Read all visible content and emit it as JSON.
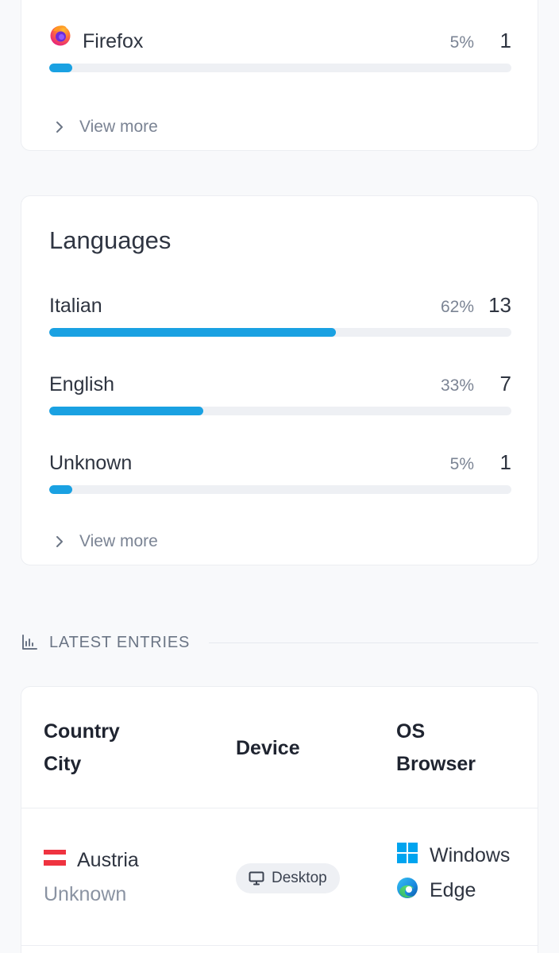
{
  "browsers_card": {
    "items": [
      {
        "label": "Firefox",
        "icon": "firefox-icon",
        "percent_text": "5%",
        "count": "1",
        "fraction": 0.05
      }
    ],
    "view_more": "View more"
  },
  "languages_card": {
    "title": "Languages",
    "items": [
      {
        "label": "Italian",
        "percent_text": "62%",
        "count": "13",
        "fraction": 0.62
      },
      {
        "label": "English",
        "percent_text": "33%",
        "count": "7",
        "fraction": 0.334
      },
      {
        "label": "Unknown",
        "percent_text": "5%",
        "count": "1",
        "fraction": 0.05
      }
    ],
    "view_more": "View more"
  },
  "latest_entries": {
    "section_label": "LATEST ENTRIES",
    "section_icon": "bar-chart-icon",
    "columns": {
      "country_city": [
        "Country",
        "City"
      ],
      "device": "Device",
      "os_browser": [
        "OS",
        "Browser"
      ]
    },
    "rows": [
      {
        "country": "Austria",
        "country_flag": "austria-flag",
        "city": "Unknown",
        "device": "Desktop",
        "device_icon": "monitor-icon",
        "os": "Windows",
        "os_icon": "windows-icon",
        "browser": "Edge",
        "browser_icon": "edge-icon"
      }
    ]
  },
  "colors": {
    "accent_bar": "#1aa1e2",
    "track": "#eef0f4",
    "austria_red": "#ef3340",
    "windows_blue": "#00a4ef"
  }
}
